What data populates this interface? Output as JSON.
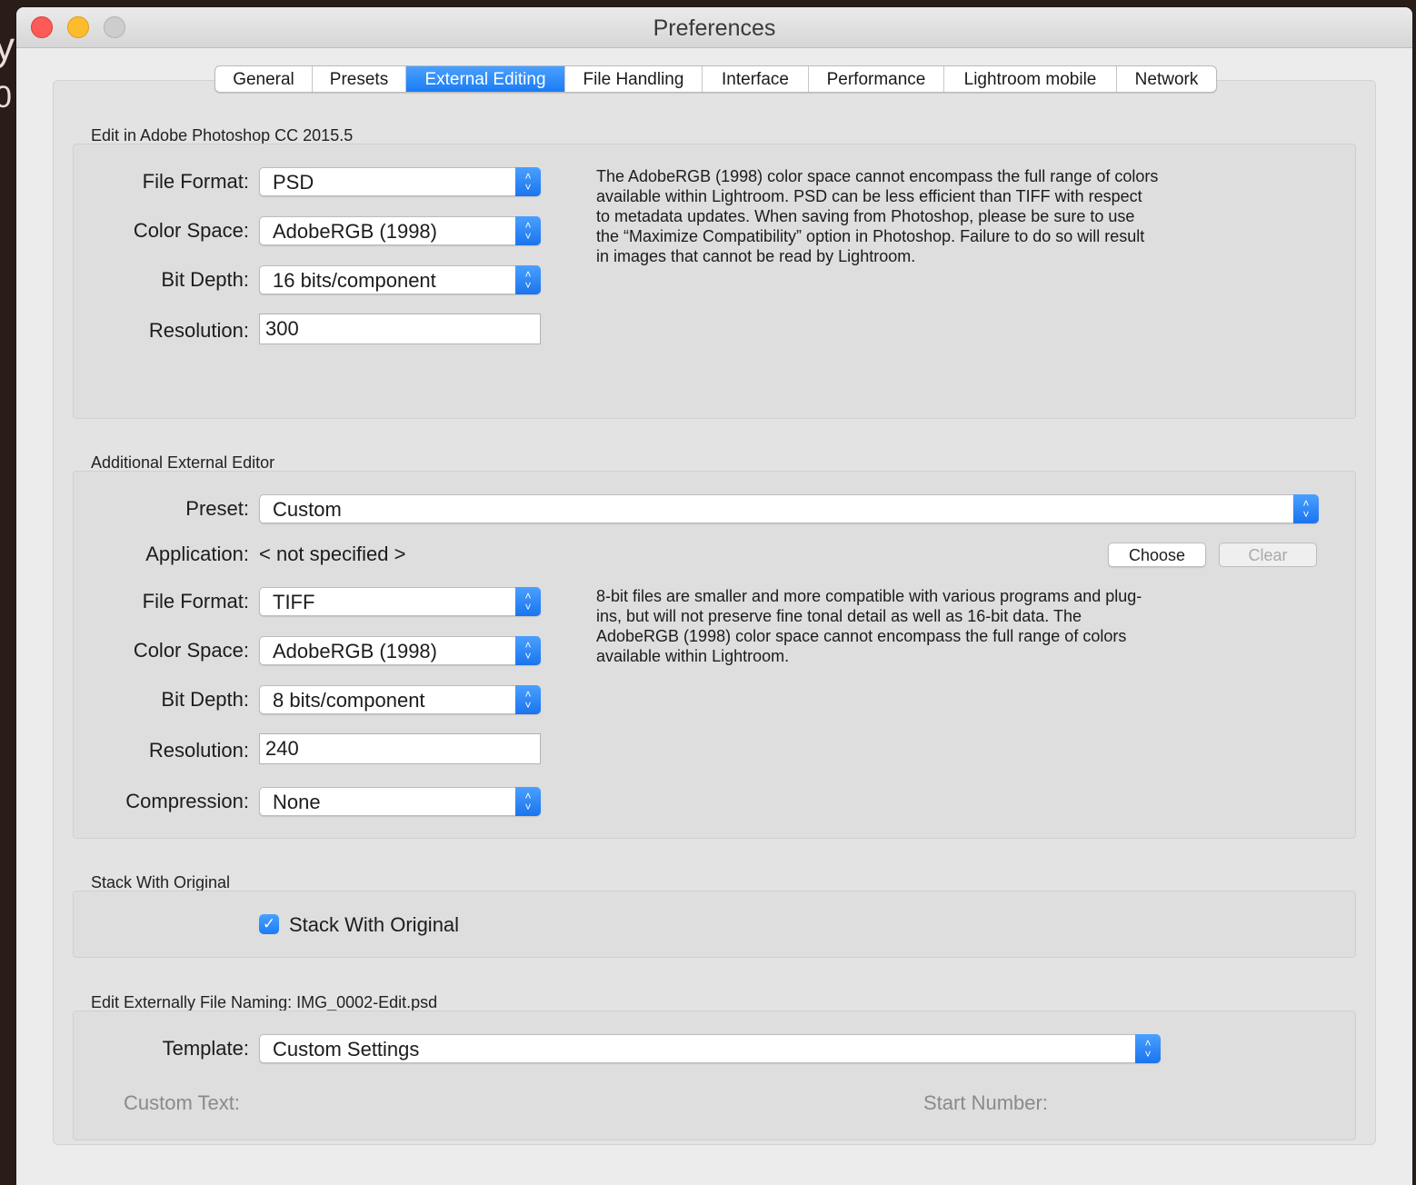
{
  "window": {
    "title": "Preferences"
  },
  "tabs": [
    {
      "label": "General"
    },
    {
      "label": "Presets"
    },
    {
      "label": "External Editing"
    },
    {
      "label": "File Handling"
    },
    {
      "label": "Interface"
    },
    {
      "label": "Performance"
    },
    {
      "label": "Lightroom mobile"
    },
    {
      "label": "Network"
    }
  ],
  "active_tab": "External Editing",
  "photoshop": {
    "section_title": "Edit in Adobe Photoshop CC 2015.5",
    "file_format": {
      "label": "File Format:",
      "value": "PSD"
    },
    "color_space": {
      "label": "Color Space:",
      "value": "AdobeRGB (1998)"
    },
    "bit_depth": {
      "label": "Bit Depth:",
      "value": "16 bits/component"
    },
    "resolution": {
      "label": "Resolution:",
      "value": "300"
    },
    "description": "The AdobeRGB (1998) color space cannot encompass the full range of colors available within Lightroom. PSD can be less efficient than TIFF with respect to metadata updates. When saving from Photoshop, please be sure to use the “Maximize Compatibility” option in Photoshop. Failure to do so will result in images that cannot be read by Lightroom."
  },
  "additional_editor": {
    "section_title": "Additional External Editor",
    "preset": {
      "label": "Preset:",
      "value": "Custom"
    },
    "application": {
      "label": "Application:",
      "value": "< not specified >"
    },
    "choose_label": "Choose",
    "clear_label": "Clear",
    "file_format": {
      "label": "File Format:",
      "value": "TIFF"
    },
    "color_space": {
      "label": "Color Space:",
      "value": "AdobeRGB (1998)"
    },
    "bit_depth": {
      "label": "Bit Depth:",
      "value": "8 bits/component"
    },
    "resolution": {
      "label": "Resolution:",
      "value": "240"
    },
    "compression": {
      "label": "Compression:",
      "value": "None"
    },
    "description": "8-bit files are smaller and more compatible with various programs and plug-ins, but will not preserve fine tonal detail as well as 16-bit data. The AdobeRGB (1998) color space cannot encompass the full range of colors available within Lightroom."
  },
  "stack": {
    "section_title": "Stack With Original",
    "checkbox_label": "Stack With Original",
    "checked": true
  },
  "naming": {
    "section_title": "Edit Externally File Naming:  IMG_0002-Edit.psd",
    "template": {
      "label": "Template:",
      "value": "Custom Settings"
    },
    "custom_text_label": "Custom Text:",
    "start_number_label": "Start Number:"
  },
  "colors": {
    "accent": "#1a7cf5",
    "close": "#fc5b57",
    "minimize": "#fdbb2e"
  }
}
